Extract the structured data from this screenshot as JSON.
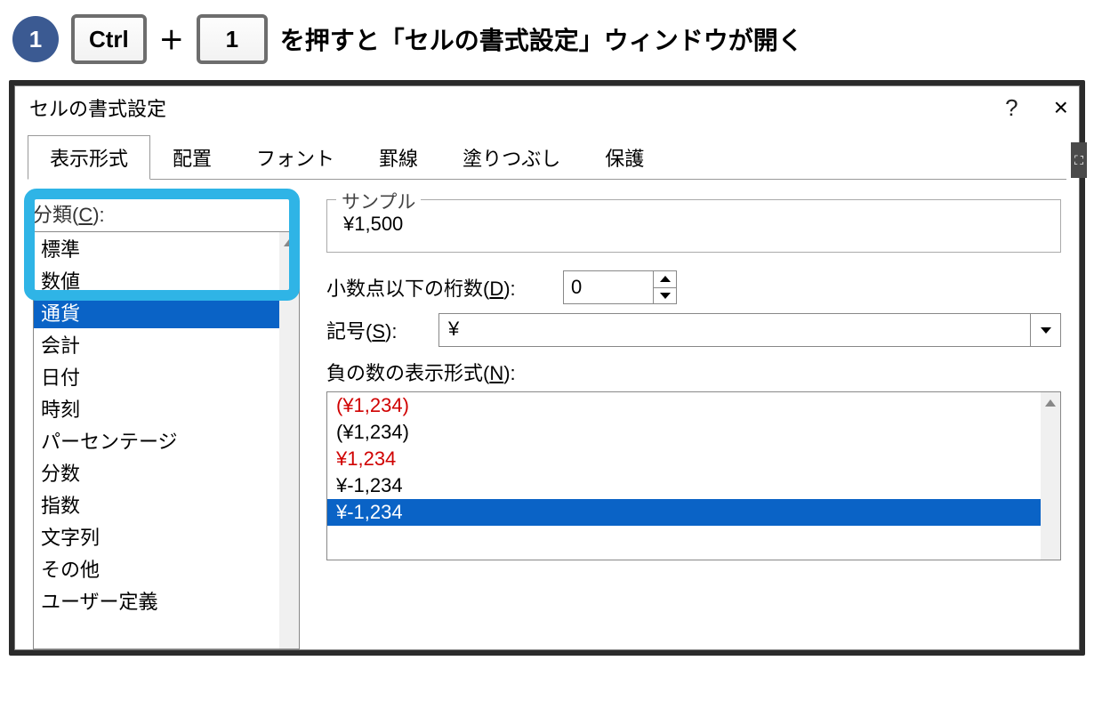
{
  "instruction": {
    "step_number": "1",
    "key_ctrl": "Ctrl",
    "plus": "＋",
    "key_one": "1",
    "text": "を押すと「セルの書式設定」ウィンドウが開く"
  },
  "dialog": {
    "title": "セルの書式設定",
    "help": "?",
    "close": "×"
  },
  "tabs": [
    {
      "id": "number",
      "label": "表示形式",
      "active": true
    },
    {
      "id": "align",
      "label": "配置",
      "active": false
    },
    {
      "id": "font",
      "label": "フォント",
      "active": false
    },
    {
      "id": "border",
      "label": "罫線",
      "active": false
    },
    {
      "id": "fill",
      "label": "塗りつぶし",
      "active": false
    },
    {
      "id": "protect",
      "label": "保護",
      "active": false
    }
  ],
  "category": {
    "label_pre": "分類(",
    "mnemonic": "C",
    "label_post": "):",
    "items": [
      {
        "label": "標準",
        "selected": false
      },
      {
        "label": "数値",
        "selected": false
      },
      {
        "label": "通貨",
        "selected": true
      },
      {
        "label": "会計",
        "selected": false
      },
      {
        "label": "日付",
        "selected": false
      },
      {
        "label": "時刻",
        "selected": false
      },
      {
        "label": "パーセンテージ",
        "selected": false
      },
      {
        "label": "分数",
        "selected": false
      },
      {
        "label": "指数",
        "selected": false
      },
      {
        "label": "文字列",
        "selected": false
      },
      {
        "label": "その他",
        "selected": false
      },
      {
        "label": "ユーザー定義",
        "selected": false
      }
    ]
  },
  "sample": {
    "legend": "サンプル",
    "value": "¥1,500"
  },
  "decimals": {
    "label_pre": "小数点以下の桁数(",
    "mnemonic": "D",
    "label_post": "):",
    "value": "0"
  },
  "symbol": {
    "label_pre": "記号(",
    "mnemonic": "S",
    "label_post": "):",
    "value": "¥"
  },
  "neg": {
    "label_pre": "負の数の表示形式(",
    "mnemonic": "N",
    "label_post": "):",
    "items": [
      {
        "text": "(¥1,234)",
        "red": true,
        "selected": false
      },
      {
        "text": "(¥1,234)",
        "red": false,
        "selected": false
      },
      {
        "text": "¥1,234",
        "red": true,
        "selected": false
      },
      {
        "text": "¥-1,234",
        "red": false,
        "selected": false
      },
      {
        "text": "¥-1,234",
        "red": true,
        "selected": true
      }
    ]
  },
  "side_icon": "⛶"
}
